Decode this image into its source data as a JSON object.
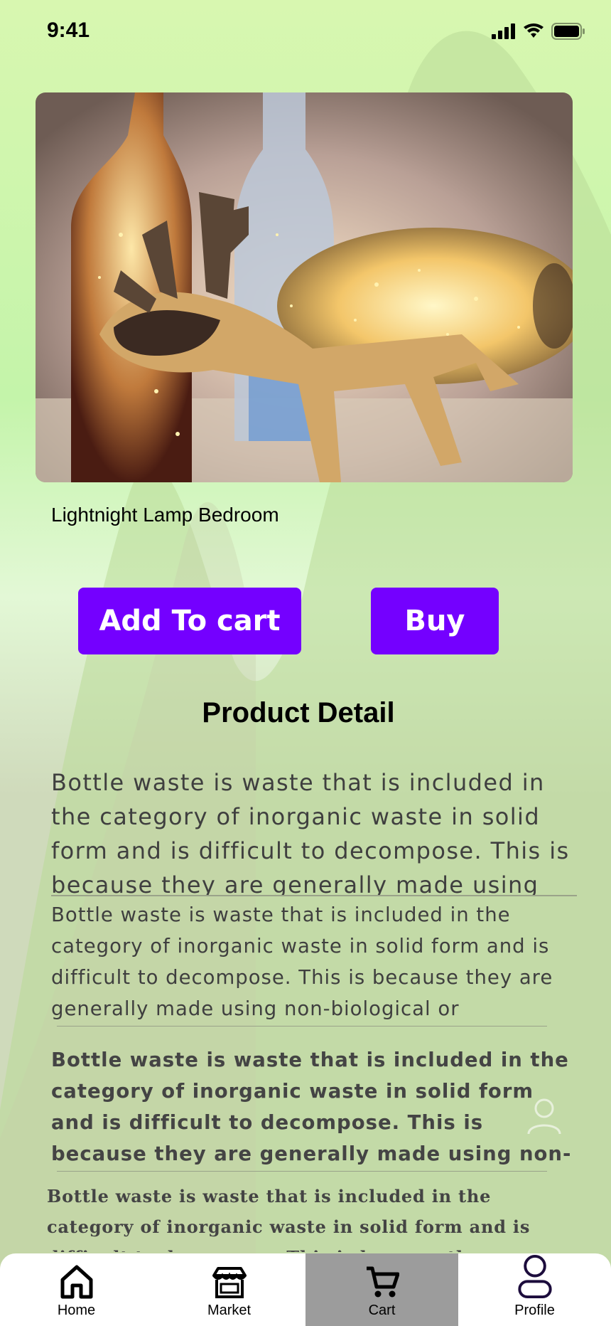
{
  "status_bar": {
    "time": "9:41"
  },
  "product": {
    "name": "Lightnight Lamp Bedroom",
    "image_alt": "Bottle lamp with wooden deer stand"
  },
  "actions": {
    "add_to_cart_label": "Add To cart",
    "buy_label": "Buy"
  },
  "detail": {
    "title": "Product Detail",
    "paragraphs": [
      "Bottle waste is waste that is included in the category of inorganic waste in solid form and is difficult to decompose. This is because they are generally made using",
      "Bottle waste is waste that is included in the category of inorganic waste in solid form and is difficult to decompose. This is because they are generally made using non-biological or",
      "Bottle waste is waste that is included in the category of inorganic waste in solid form and is difficult to decompose. This is because they are generally made using non-biological or",
      "Bottle waste is waste that is included in the category of inorganic waste in solid form and is difficult to decompose. This is because they are generally made"
    ]
  },
  "nav": {
    "items": [
      {
        "label": "Home",
        "icon": "home-icon"
      },
      {
        "label": "Market",
        "icon": "store-icon"
      },
      {
        "label": "Cart",
        "icon": "cart-icon",
        "active": true
      },
      {
        "label": "Profile",
        "icon": "user-icon"
      }
    ]
  },
  "colors": {
    "accent": "#7400ff",
    "active_tab": "#9c9c9c"
  }
}
